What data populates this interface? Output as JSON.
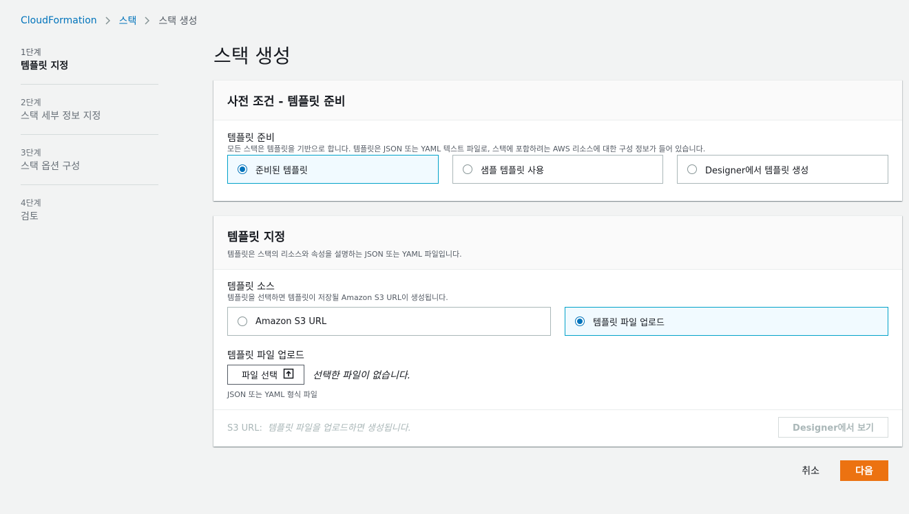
{
  "breadcrumb": {
    "items": [
      "CloudFormation",
      "스택",
      "스택 생성"
    ]
  },
  "steps": [
    {
      "num": "1단계",
      "name": "템플릿 지정"
    },
    {
      "num": "2단계",
      "name": "스택 세부 정보 지정"
    },
    {
      "num": "3단계",
      "name": "스택 옵션 구성"
    },
    {
      "num": "4단계",
      "name": "검토"
    }
  ],
  "page_title": "스택 생성",
  "prereq": {
    "title": "사전 조건 - 템플릿 준비",
    "label": "템플릿 준비",
    "desc": "모든 스택은 템플릿을 기반으로 합니다. 템플릿은 JSON 또는 YAML 텍스트 파일로, 스택에 포함하려는 AWS 리소스에 대한 구성 정보가 들어 있습니다.",
    "options": [
      "준비된 템플릿",
      "샘플 템플릿 사용",
      "Designer에서 템플릿 생성"
    ],
    "selected": "준비된 템플릿"
  },
  "specify": {
    "title": "템플릿 지정",
    "desc": "템플릿은 스택의 리소스와 속성을 설명하는 JSON 또는 YAML 파일입니다.",
    "source_label": "템플릿 소스",
    "source_desc": "템플릿을 선택하면 템플릿이 저장될 Amazon S3 URL이 생성됩니다.",
    "source_options": [
      "Amazon S3 URL",
      "템플릿 파일 업로드"
    ],
    "source_selected": "템플릿 파일 업로드",
    "upload_label": "템플릿 파일 업로드",
    "file_button": "파일 선택",
    "no_file": "선택한 파일이 없습니다.",
    "upload_hint": "JSON 또는 YAML 형식 파일",
    "s3_url_label": "S3 URL:",
    "s3_url_value": "템플릿 파일을 업로드하면 생성됩니다.",
    "designer_button": "Designer에서 보기"
  },
  "footer": {
    "cancel": "취소",
    "next": "다음"
  },
  "colors": {
    "link": "#0073bb",
    "primary": "#ec7211",
    "selected_border": "#00a1c9",
    "selected_bg": "#f1faff"
  }
}
